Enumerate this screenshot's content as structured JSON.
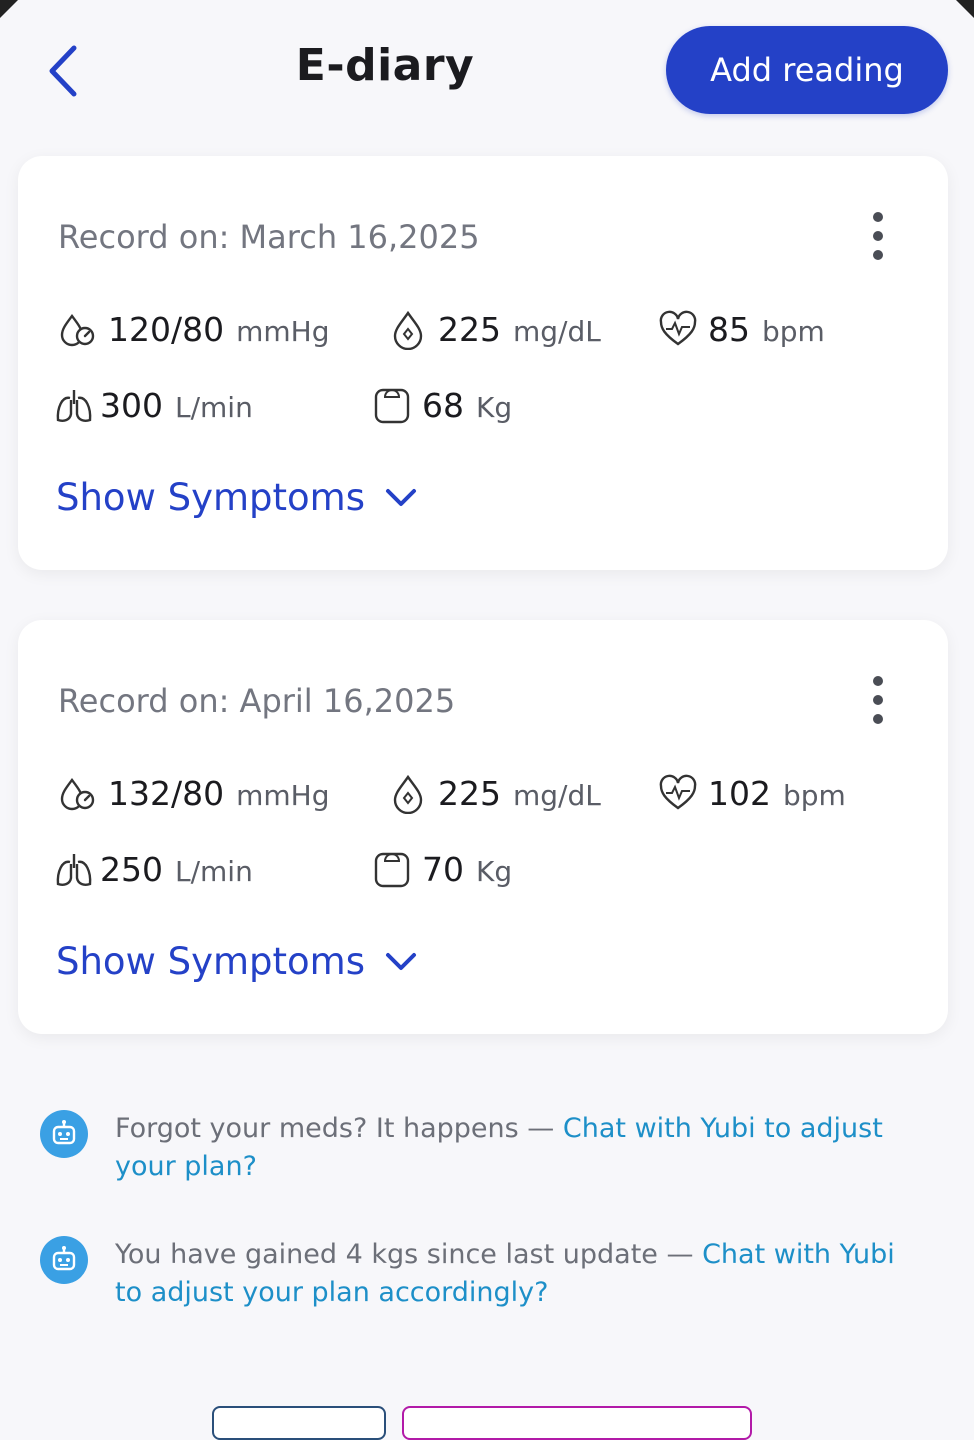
{
  "header": {
    "title": "E-diary",
    "add_label": "Add reading"
  },
  "records": [
    {
      "date_label": "Record on: March 16,2025",
      "bp_value": "120/80",
      "bp_unit": "mmHg",
      "glucose_value": "225",
      "glucose_unit": "mg/dL",
      "hr_value": "85",
      "hr_unit": "bpm",
      "lung_value": "300",
      "lung_unit": "L/min",
      "weight_value": "68",
      "weight_unit": "Kg",
      "toggle_label": "Show Symptoms"
    },
    {
      "date_label": "Record on: April 16,2025",
      "bp_value": "132/80",
      "bp_unit": "mmHg",
      "glucose_value": "225",
      "glucose_unit": "mg/dL",
      "hr_value": "102",
      "hr_unit": "bpm",
      "lung_value": "250",
      "lung_unit": "L/min",
      "weight_value": "70",
      "weight_unit": "Kg",
      "toggle_label": "Show Symptoms"
    }
  ],
  "tips": [
    {
      "text": "Forgot your meds? It happens  — ",
      "link": "Chat with Yubi to adjust your plan?"
    },
    {
      "text": "You have gained 4 kgs since last update  — ",
      "link": "Chat with Yubi to adjust your plan accordingly?"
    }
  ],
  "colors": {
    "primary": "#2441c7",
    "link": "#1d8fc8",
    "bot": "#3aa0e4",
    "date_text": "#737680"
  }
}
